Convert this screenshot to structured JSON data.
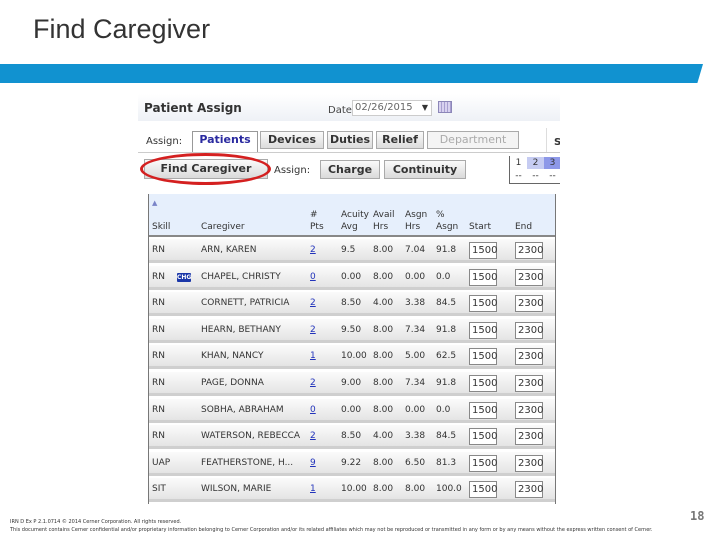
{
  "slide": {
    "title": "Find Caregiver",
    "accent_color": "#1192d0",
    "page_number": "18",
    "footer_line1": "IRN D Ex P 2.1.0714     © 2014 Cerner Corporation. All rights reserved.",
    "footer_line2": "This document contains Cerner confidential and/or proprietary information belonging to Cerner Corporation and/or its related affiliates which may not be reproduced or transmitted in any form or by any means without the express written consent of Cerner."
  },
  "app": {
    "title": "Patient Assign",
    "date_label": "Date:",
    "date_value": "02/26/2015",
    "assign_label": "Assign:",
    "tabs": [
      {
        "label": "Patients",
        "state": "active"
      },
      {
        "label": "Devices",
        "state": "normal"
      },
      {
        "label": "Duties",
        "state": "normal"
      },
      {
        "label": "Relief",
        "state": "normal"
      },
      {
        "label": "Department",
        "state": "disabled"
      }
    ],
    "s_truncated": "S",
    "find_caregiver_button": "Find Caregiver",
    "sub_assign_label": "Assign:",
    "sub_buttons": [
      "Charge",
      "Continuity"
    ],
    "shift_grid": {
      "numbers": [
        "1",
        "2",
        "3"
      ],
      "values": [
        "--",
        "--",
        "--"
      ]
    },
    "highlight_color": "#d42020"
  },
  "table": {
    "headers": {
      "skill": "Skill",
      "caregiver": "Caregiver",
      "pts_1": "#",
      "pts_2": "Pts",
      "acuity_1": "Acuity",
      "acuity_2": "Avg",
      "avail_1": "Avail",
      "avail_2": "Hrs",
      "asgn_1": "Asgn",
      "asgn_2": "Hrs",
      "pct_1": "%",
      "pct_2": "Asgn",
      "start": "Start",
      "end": "End"
    },
    "rows": [
      {
        "skill": "RN",
        "badge": "",
        "caregiver": "ARN, KAREN",
        "pts": "2",
        "acuity": "9.5",
        "avail": "8.00",
        "asgn": "7.04",
        "pct": "91.8",
        "start": "1500",
        "end": "2300"
      },
      {
        "skill": "RN",
        "badge": "CHG",
        "caregiver": "CHAPEL, CHRISTY",
        "pts": "0",
        "acuity": "0.00",
        "avail": "8.00",
        "asgn": "0.00",
        "pct": "0.0",
        "start": "1500",
        "end": "2300"
      },
      {
        "skill": "RN",
        "badge": "",
        "caregiver": "CORNETT, PATRICIA",
        "pts": "2",
        "acuity": "8.50",
        "avail": "4.00",
        "asgn": "3.38",
        "pct": "84.5",
        "start": "1500",
        "end": "2300"
      },
      {
        "skill": "RN",
        "badge": "",
        "caregiver": "HEARN, BETHANY",
        "pts": "2",
        "acuity": "9.50",
        "avail": "8.00",
        "asgn": "7.34",
        "pct": "91.8",
        "start": "1500",
        "end": "2300"
      },
      {
        "skill": "RN",
        "badge": "",
        "caregiver": "KHAN, NANCY",
        "pts": "1",
        "acuity": "10.00",
        "avail": "8.00",
        "asgn": "5.00",
        "pct": "62.5",
        "start": "1500",
        "end": "2300"
      },
      {
        "skill": "RN",
        "badge": "",
        "caregiver": "PAGE, DONNA",
        "pts": "2",
        "acuity": "9.00",
        "avail": "8.00",
        "asgn": "7.34",
        "pct": "91.8",
        "start": "1500",
        "end": "2300"
      },
      {
        "skill": "RN",
        "badge": "",
        "caregiver": "SOBHA, ABRAHAM",
        "pts": "0",
        "acuity": "0.00",
        "avail": "8.00",
        "asgn": "0.00",
        "pct": "0.0",
        "start": "1500",
        "end": "2300"
      },
      {
        "skill": "RN",
        "badge": "",
        "caregiver": "WATERSON, REBECCA",
        "pts": "2",
        "acuity": "8.50",
        "avail": "4.00",
        "asgn": "3.38",
        "pct": "84.5",
        "start": "1500",
        "end": "2300"
      },
      {
        "skill": "UAP",
        "badge": "",
        "caregiver": "FEATHERSTONE, H...",
        "pts": "9",
        "acuity": "9.22",
        "avail": "8.00",
        "asgn": "6.50",
        "pct": "81.3",
        "start": "1500",
        "end": "2300"
      },
      {
        "skill": "SIT",
        "badge": "",
        "caregiver": "WILSON, MARIE",
        "pts": "1",
        "acuity": "10.00",
        "avail": "8.00",
        "asgn": "8.00",
        "pct": "100.0",
        "start": "1500",
        "end": "2300"
      }
    ]
  }
}
